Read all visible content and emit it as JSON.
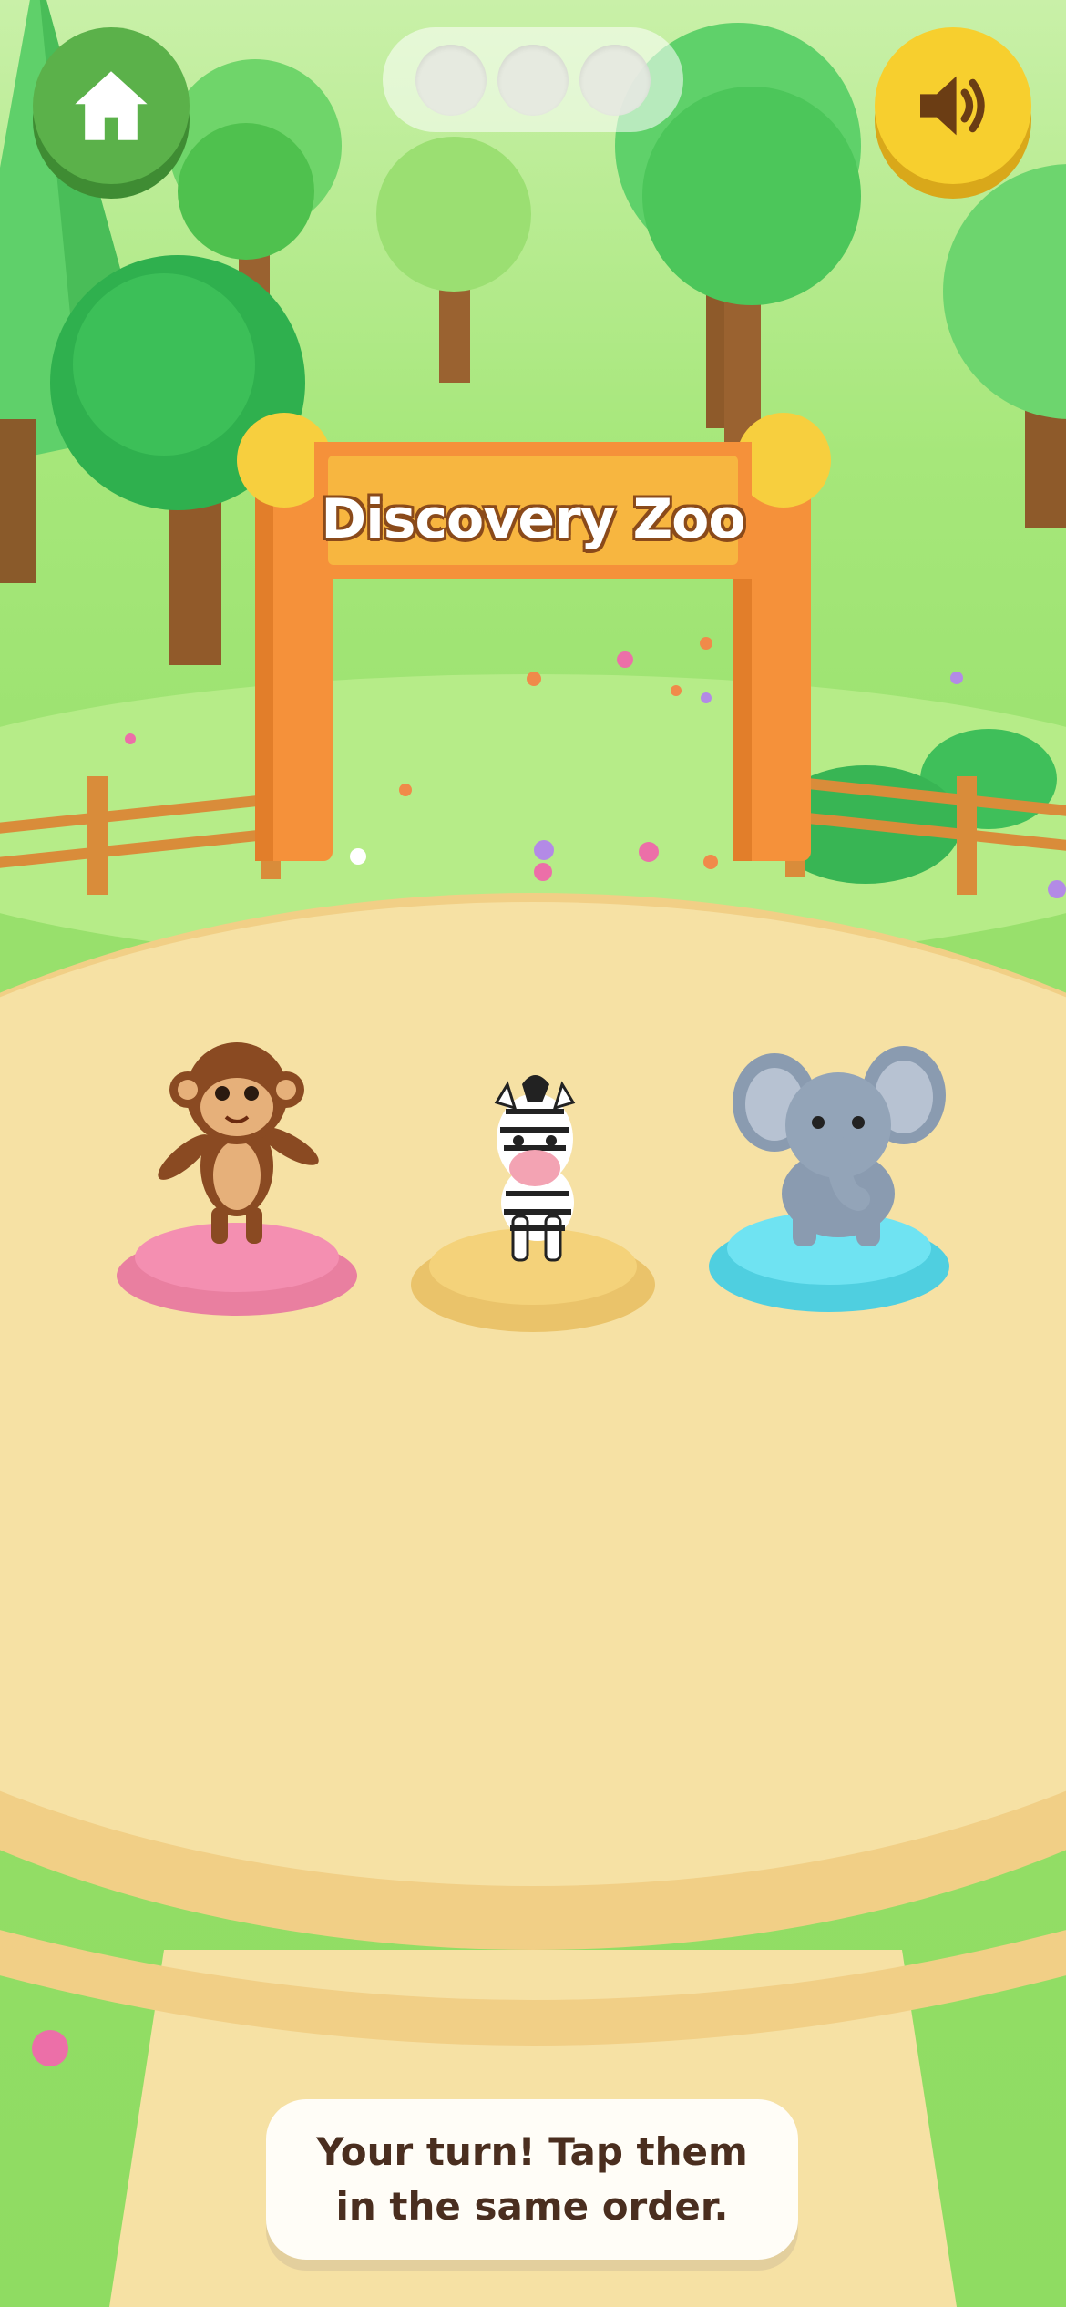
{
  "sign": {
    "title": "Discovery Zoo"
  },
  "progress": {
    "total": 3,
    "filled": 0
  },
  "buttons": {
    "home_icon": "home-icon",
    "sound_icon": "speaker-icon"
  },
  "animals": [
    {
      "name": "monkey",
      "pedestal_color": "#f48fb1"
    },
    {
      "name": "zebra",
      "pedestal_color": "#f4d27a"
    },
    {
      "name": "elephant",
      "pedestal_color": "#6fe3f2"
    }
  ],
  "instruction": {
    "line1": "Your turn! Tap them",
    "line2": "in the same order."
  },
  "colors": {
    "home": "#5bb14a",
    "sound": "#f7cf2e",
    "sand": "#f6e1a4"
  }
}
